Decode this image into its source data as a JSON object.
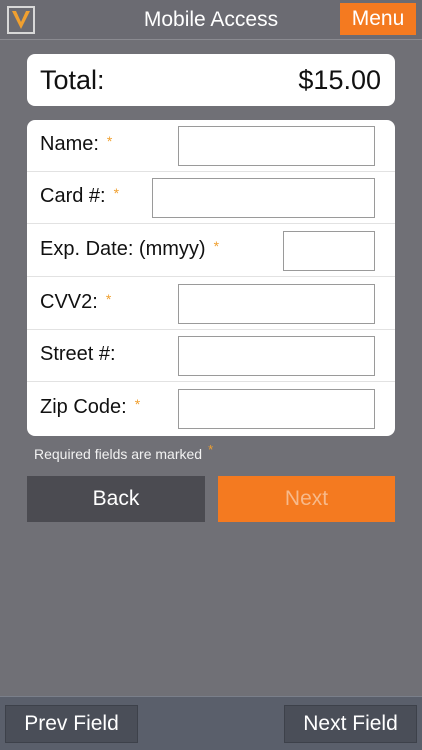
{
  "header": {
    "title": "Mobile Access",
    "menu_label": "Menu",
    "logo_icon": "v-logo-icon"
  },
  "total": {
    "label": "Total:",
    "amount": "$15.00"
  },
  "form": {
    "required_marker": "*",
    "fields": [
      {
        "label": "Name:",
        "required": true,
        "value": ""
      },
      {
        "label": "Card #:",
        "required": true,
        "value": ""
      },
      {
        "label": "Exp. Date: (mmyy)",
        "required": true,
        "value": ""
      },
      {
        "label": "CVV2:",
        "required": true,
        "value": ""
      },
      {
        "label": "Street #:",
        "required": false,
        "value": ""
      },
      {
        "label": "Zip Code:",
        "required": true,
        "value": ""
      }
    ]
  },
  "note": {
    "text": "Required fields are marked",
    "marker": "*"
  },
  "actions": {
    "back_label": "Back",
    "next_label": "Next"
  },
  "toolbar": {
    "prev_label": "Prev Field",
    "next_label": "Next Field"
  },
  "colors": {
    "accent": "#f47a20",
    "background": "#707076",
    "required_star": "#f0a030"
  }
}
